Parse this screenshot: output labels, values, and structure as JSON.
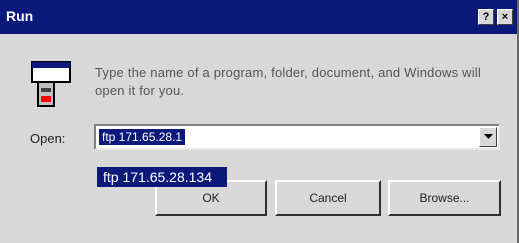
{
  "window": {
    "title": "Run",
    "help_glyph": "?",
    "close_glyph": "×"
  },
  "icon": "run-program-icon",
  "prompt_text": "Type the name of a program, folder, document, and Windows will open it for you.",
  "open_field": {
    "label": "Open:",
    "value": "ftp 171.65.28.1"
  },
  "tooltip_text": "ftp 171.65.28.134",
  "buttons": {
    "ok": "OK",
    "cancel": "Cancel",
    "browse": "Browse..."
  },
  "colors": {
    "title_bar": "#0b1a7a",
    "dialog_bg": "#d8d8d8",
    "selection": "#0b1a7a"
  }
}
